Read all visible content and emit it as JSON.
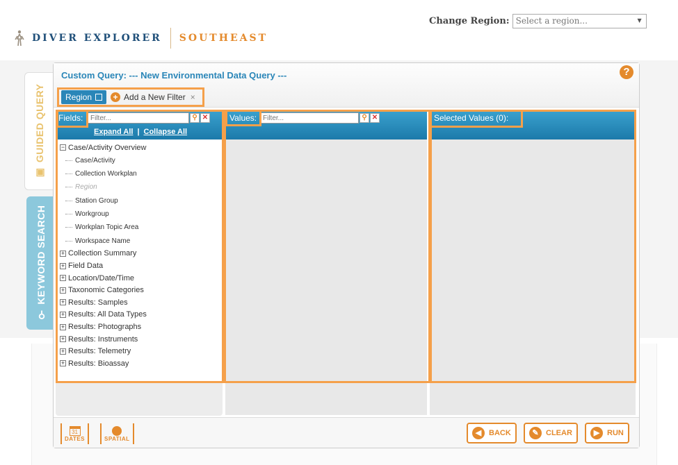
{
  "header": {
    "brand": "DIVER EXPLORER",
    "region_name": "SOUTHEAST",
    "change_region_label": "Change Region:",
    "region_select_value": "Select a region..."
  },
  "side_tabs": {
    "guided": "GUIDED QUERY",
    "keyword": "KEYWORD SEARCH"
  },
  "panel": {
    "title": "Custom Query: --- New Environmental Data Query ---",
    "help": "?",
    "tabs": {
      "region": "Region",
      "add_filter": "Add a New Filter",
      "close": "×"
    }
  },
  "fields": {
    "label": "Fields:",
    "filter_placeholder": "Filter...",
    "expand_all": "Expand All",
    "separator": "|",
    "collapse_all": "Collapse All",
    "tree": {
      "expanded_group": "Case/Activity Overview",
      "children": [
        {
          "label": "Case/Activity",
          "disabled": false
        },
        {
          "label": "Collection Workplan",
          "disabled": false
        },
        {
          "label": "Region",
          "disabled": true
        },
        {
          "label": "Station Group",
          "disabled": false
        },
        {
          "label": "Workgroup",
          "disabled": false
        },
        {
          "label": "Workplan Topic Area",
          "disabled": false
        },
        {
          "label": "Workspace Name",
          "disabled": false
        }
      ],
      "collapsed_groups": [
        "Collection Summary",
        "Field Data",
        "Location/Date/Time",
        "Taxonomic Categories",
        "Results: Samples",
        "Results: All Data Types",
        "Results: Photographs",
        "Results: Instruments",
        "Results: Telemetry",
        "Results: Bioassay"
      ]
    }
  },
  "values": {
    "label": "Values:",
    "filter_placeholder": "Filter..."
  },
  "selected": {
    "label": "Selected Values (0):"
  },
  "footer": {
    "dates": "DATES",
    "calendar_day": "31",
    "spatial": "SPATIAL",
    "back": "BACK",
    "clear": "CLEAR",
    "run": "RUN"
  },
  "colors": {
    "accent_orange": "#e48a2c",
    "highlight_outline": "#f5a04a",
    "header_blue": "#2a86b8",
    "brand_navy": "#20507a"
  }
}
